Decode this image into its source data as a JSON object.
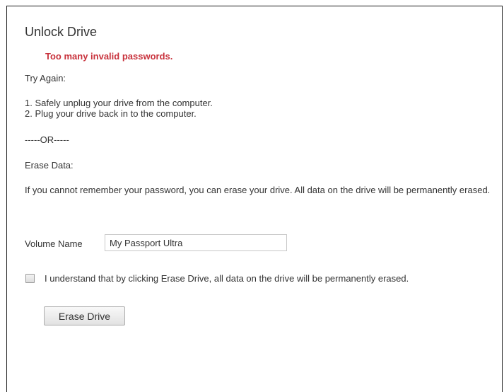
{
  "dialog": {
    "title": "Unlock Drive",
    "error_message": "Too many invalid passwords.",
    "try_again_heading": "Try Again:",
    "steps": [
      "1. Safely unplug your drive from the computer.",
      "2. Plug your drive back in to the computer."
    ],
    "separator": "-----OR-----",
    "erase_heading": "Erase Data:",
    "erase_description": "If you cannot remember your password, you can erase your drive. All data on the drive will be permanently erased.",
    "volume_name_label": "Volume Name",
    "volume_name_value": "My Passport Ultra",
    "confirm_checkbox_label": "I understand that by clicking Erase Drive, all data on the drive will be permanently erased.",
    "confirm_checked": false,
    "erase_button_label": "Erase Drive"
  },
  "colors": {
    "error": "#c8323c",
    "text": "#333333",
    "frame_border": "#1a1a1a"
  }
}
